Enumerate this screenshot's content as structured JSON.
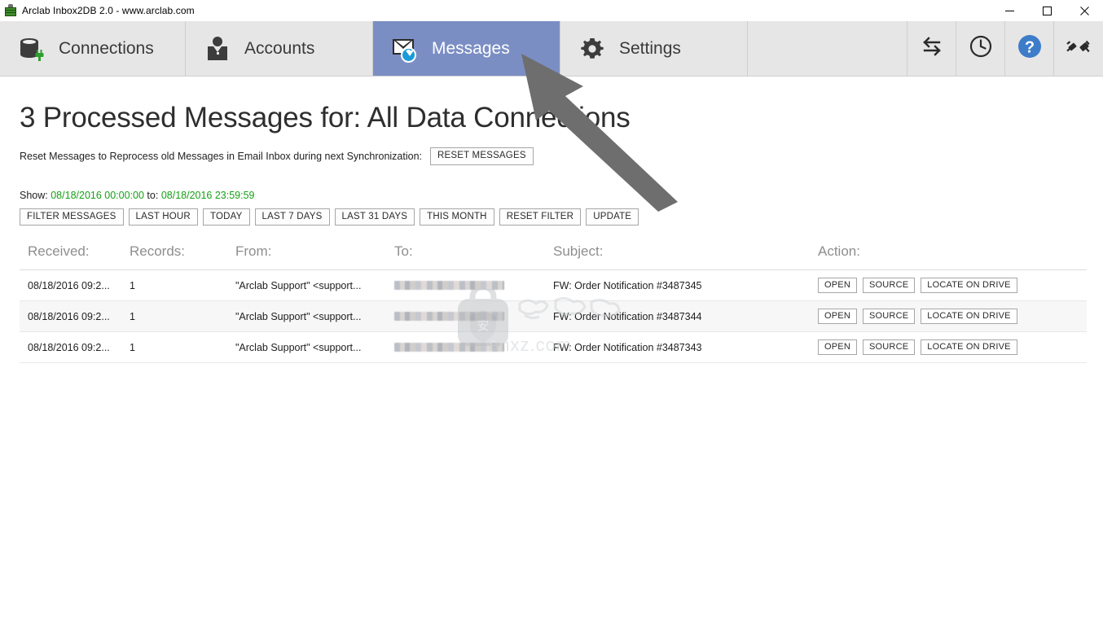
{
  "window": {
    "title": "Arclab Inbox2DB 2.0 - www.arclab.com",
    "icon": "database-stack-icon",
    "controls": {
      "minimize": "minimize-icon",
      "maximize": "maximize-icon",
      "close": "close-icon"
    }
  },
  "tabs": [
    {
      "label": "Connections",
      "icon": "database-connection-icon",
      "active": false
    },
    {
      "label": "Accounts",
      "icon": "user-account-icon",
      "active": false
    },
    {
      "label": "Messages",
      "icon": "envelope-download-icon",
      "active": true
    },
    {
      "label": "Settings",
      "icon": "gear-icon",
      "active": false
    }
  ],
  "toolbar": [
    {
      "icon": "sync-arrows-icon",
      "name": "sync-button"
    },
    {
      "icon": "clock-icon",
      "name": "history-button"
    },
    {
      "icon": "help-question-icon",
      "name": "help-button"
    },
    {
      "icon": "plug-disconnect-icon",
      "name": "disconnect-button"
    }
  ],
  "main": {
    "page_title": "3 Processed Messages for: All Data Connections",
    "reset_label": "Reset Messages to Reprocess old Messages in Email Inbox during next Synchronization:",
    "reset_button": "RESET MESSAGES",
    "show_prefix": "Show:",
    "show_from": "08/18/2016 00:00:00",
    "show_middle": "to:",
    "show_to": "08/18/2016 23:59:59",
    "filter_buttons": [
      "FILTER MESSAGES",
      "LAST HOUR",
      "TODAY",
      "LAST 7 DAYS",
      "LAST 31 DAYS",
      "THIS MONTH",
      "RESET FILTER",
      "UPDATE"
    ],
    "table": {
      "headers": [
        "Received:",
        "Records:",
        "From:",
        "To:",
        "Subject:",
        "Action:"
      ],
      "row_actions": [
        "OPEN",
        "SOURCE",
        "LOCATE ON DRIVE"
      ],
      "rows": [
        {
          "received": "08/18/2016 09:2...",
          "records": "1",
          "from": "\"Arclab Support\" <support...",
          "to": "",
          "to_redacted": true,
          "subject": "FW: Order Notification #3487345"
        },
        {
          "received": "08/18/2016 09:2...",
          "records": "1",
          "from": "\"Arclab Support\" <support...",
          "to": "",
          "to_redacted": true,
          "subject": "FW: Order Notification #3487344"
        },
        {
          "received": "08/18/2016 09:2...",
          "records": "1",
          "from": "\"Arclab Support\" <support...",
          "to": "",
          "to_redacted": true,
          "subject": "FW: Order Notification #3487343"
        }
      ]
    }
  },
  "overlays": {
    "cursor_arrow": "pointer-arrow-annotation",
    "watermark_text": "anxz.com",
    "watermark_glyph": "安"
  },
  "colors": {
    "active_tab": "#7b8ec4",
    "tab_bar": "#e6e6e6",
    "date_green": "#15a015",
    "help_blue": "#3d7cc9",
    "plug_green": "#3f8c2a",
    "badge_blue": "#1a9ad8"
  }
}
